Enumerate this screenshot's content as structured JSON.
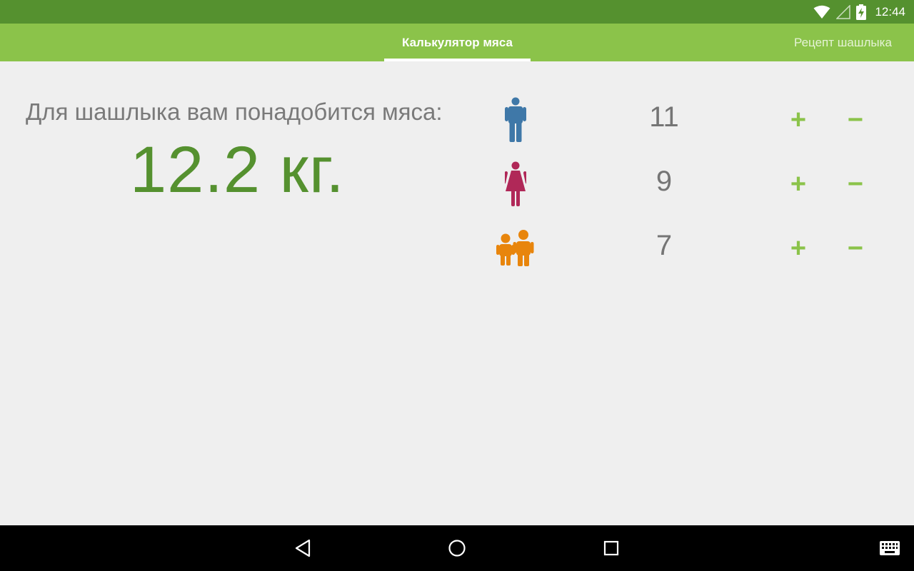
{
  "status_bar": {
    "time": "12:44",
    "icons": [
      "wifi-icon",
      "signal-icon",
      "battery-icon"
    ]
  },
  "tabs": [
    {
      "label": "Калькулятор мяса",
      "active": true
    },
    {
      "label": "Рецепт шашлыка",
      "active": false
    }
  ],
  "calculator": {
    "label": "Для шашлыка вам понадобится мяса:",
    "result": "12.2 кг."
  },
  "people": [
    {
      "type": "men",
      "icon": "man-icon",
      "count": "11",
      "color": "#3f78a8"
    },
    {
      "type": "women",
      "icon": "woman-icon",
      "count": "9",
      "color": "#b02858"
    },
    {
      "type": "children",
      "icon": "children-icon",
      "count": "7",
      "color": "#e8850c"
    }
  ],
  "controls": {
    "plus": "+",
    "minus": "−"
  },
  "colors": {
    "status_bar": "#55912f",
    "tab_bar": "#8bc34a",
    "accent": "#55912f",
    "button": "#8bc34a",
    "background": "#efefef"
  },
  "navigation": [
    "back-icon",
    "home-icon",
    "recent-apps-icon",
    "keyboard-icon"
  ]
}
